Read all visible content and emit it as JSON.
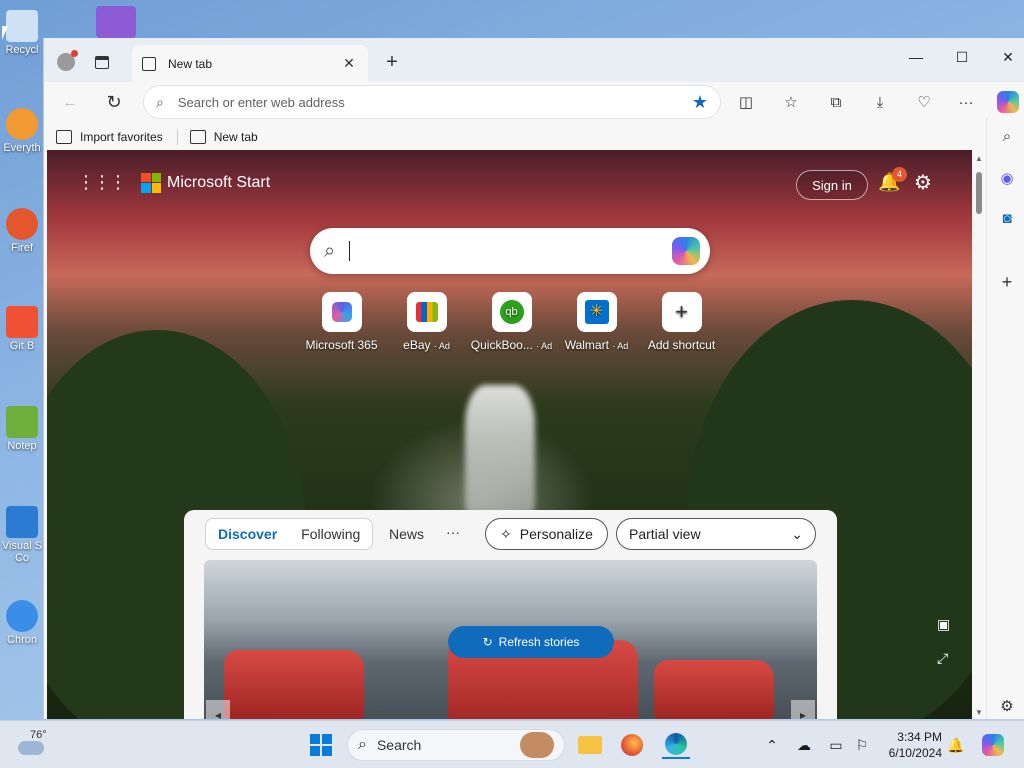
{
  "desktop": {
    "icons": [
      {
        "label": "Recycl",
        "color": "#9ec3e6"
      },
      {
        "label": "Everyth",
        "color": "#f29a32"
      },
      {
        "label": "Firef",
        "color": "#e4572e"
      },
      {
        "label": "Git B",
        "color": "#f05033"
      },
      {
        "label": "Notep",
        "color": "#6fae3a"
      },
      {
        "label": "Visual S Co",
        "color": "#2b7bd3"
      },
      {
        "label": "Chron",
        "color": "#3b8ee8"
      }
    ]
  },
  "browser": {
    "tab": {
      "label": "New tab",
      "close": "✕"
    },
    "new_tab_button": "+",
    "window_controls": {
      "minimize": "—",
      "maximize": "☐",
      "close": "✕"
    },
    "address_bar": {
      "placeholder": "Search or enter web address"
    },
    "favorites_bar": {
      "items": [
        "Import favorites",
        "New tab"
      ]
    },
    "colors": {
      "accent": "#0f6cbd",
      "star": "#0f6cbd"
    }
  },
  "page": {
    "brand": "Microsoft Start",
    "sign_in": "Sign in",
    "notification_count": "4",
    "shortcuts": [
      {
        "label": "Microsoft 365",
        "ad": "",
        "icon": "m365-icon"
      },
      {
        "label": "eBay",
        "ad": "· Ad",
        "icon": "ebay-icon"
      },
      {
        "label": "QuickBoo...",
        "ad": "· Ad",
        "icon": "quickbooks-icon"
      },
      {
        "label": "Walmart",
        "ad": "· Ad",
        "icon": "walmart-icon"
      },
      {
        "label": "Add shortcut",
        "ad": "",
        "icon": "plus-icon"
      }
    ],
    "feed": {
      "tabs": [
        "Discover",
        "Following"
      ],
      "news": "News",
      "more": "···",
      "personalize": "Personalize",
      "view_select": "Partial view",
      "refresh": "Refresh stories"
    }
  },
  "taskbar": {
    "weather": "76°",
    "search": "Search",
    "time": "3:34 PM",
    "date": "6/10/2024"
  }
}
